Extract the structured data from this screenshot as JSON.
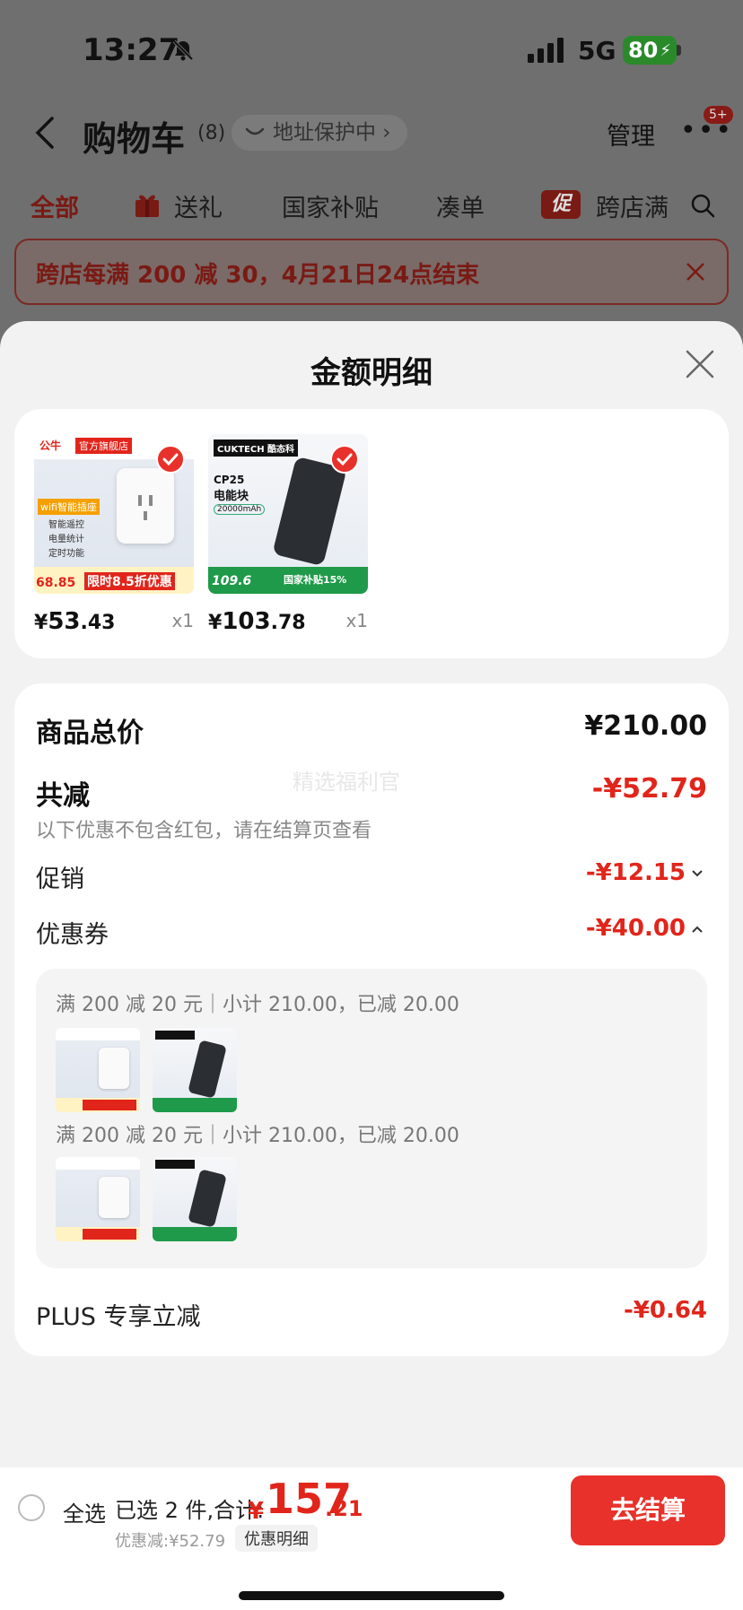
{
  "status_bar": {
    "time": "13:27",
    "network": "5G",
    "battery": "80"
  },
  "nav": {
    "title": "购物车",
    "count": "(8)",
    "address_protection": "地址保护中 ›",
    "manage": "管理",
    "more": "•••",
    "badge": "5+"
  },
  "tabs": [
    "全部",
    "送礼",
    "国家补贴",
    "凑单",
    "跨店满"
  ],
  "tab_promo_icon": "促",
  "banner": {
    "text": "跨店每满 200 减 30，4月21日24点结束"
  },
  "sheet": {
    "title": "金额明细",
    "products": [
      {
        "brand": "公牛",
        "shop_tag": "官方旗舰店",
        "feature": "wifi智能插座",
        "bullets": [
          "智能遥控",
          "电量统计",
          "定时功能"
        ],
        "price_tag": "68.85",
        "promo": "限时8.5折优惠",
        "price_symbol": "¥",
        "price_int": "53",
        "price_dec": ".43",
        "qty": "x1"
      },
      {
        "brand": "CUKTECH 酷态科",
        "model": "CP25",
        "name": "电能块",
        "capacity": "20000mAh",
        "subsidy": "国家补贴15%",
        "deal_price": "109.6",
        "price_symbol": "¥",
        "price_int": "103",
        "price_dec": ".78",
        "qty": "x1"
      }
    ],
    "summary": {
      "total_label": "商品总价",
      "total_value": "¥210.00",
      "reduce_label": "共减",
      "reduce_value": "-¥52.79",
      "note": "以下优惠不包含红包，请在结算页查看",
      "watermark": "精选福利官",
      "promo_label": "促销",
      "promo_value": "-¥12.15",
      "coupon_label": "优惠券",
      "coupon_value": "-¥40.00",
      "coupon_lines": [
        "满 200 减 20 元｜小计 210.00，已减 20.00",
        "满 200 减 20 元｜小计 210.00，已减 20.00"
      ],
      "plus_label": "PLUS 专享立减",
      "plus_value": "-¥0.64"
    }
  },
  "bottom_bar": {
    "select_all": "全选",
    "selected": "已选 2 件,合计:",
    "total_symbol": "¥",
    "total_int": "157",
    "total_dec": ".21",
    "discount": "优惠减:¥52.79",
    "detail": "优惠明细",
    "checkout": "去结算"
  },
  "colors": {
    "accent": "#e1251b",
    "checkout": "#e8312a",
    "sheet_bg": "#f2f2f2"
  }
}
